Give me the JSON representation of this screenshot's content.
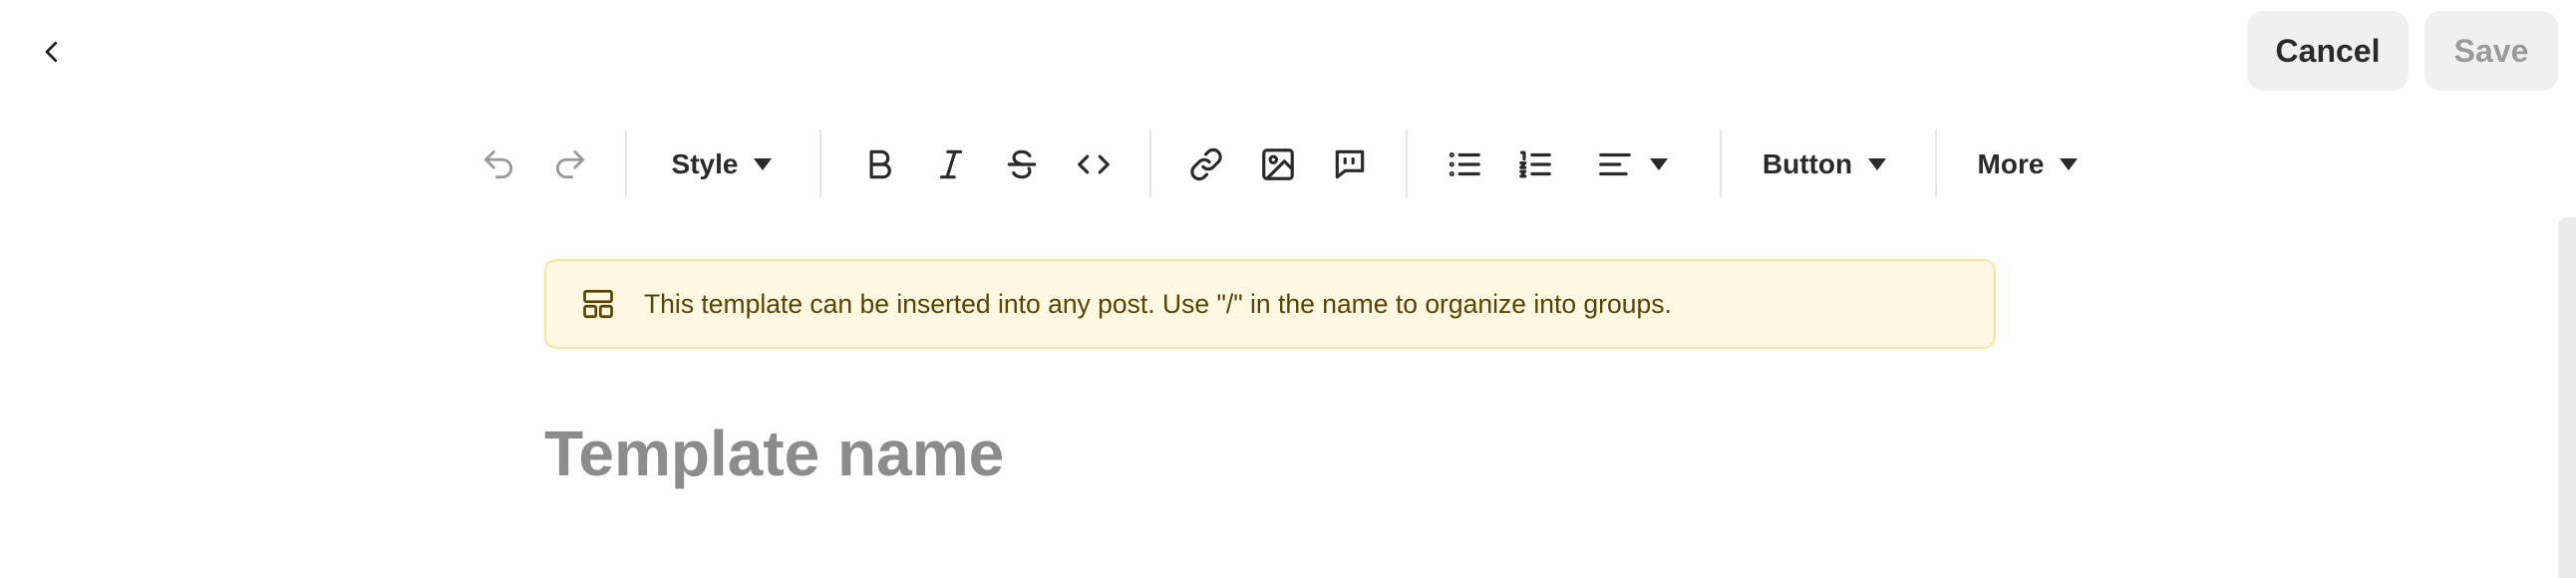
{
  "header": {
    "cancel_label": "Cancel",
    "save_label": "Save"
  },
  "toolbar": {
    "style_label": "Style",
    "button_label": "Button",
    "more_label": "More"
  },
  "banner": {
    "text": "This template can be inserted into any post. Use \"/\" in the name to organize into groups."
  },
  "editor": {
    "title_placeholder": "Template name",
    "title_value": ""
  },
  "icons": {
    "back": "chevron-left-icon",
    "undo": "undo-icon",
    "redo": "redo-icon",
    "bold": "bold-icon",
    "italic": "italic-icon",
    "strikethrough": "strikethrough-icon",
    "code": "code-icon",
    "link": "link-icon",
    "image": "image-icon",
    "quote": "quote-icon",
    "bullet_list": "bullet-list-icon",
    "numbered_list": "numbered-list-icon",
    "align": "align-left-icon",
    "template": "template-icon"
  },
  "colors": {
    "banner_bg": "#fff8e3",
    "banner_border": "#f6e4a3",
    "banner_text": "#5a4300",
    "button_bg": "#f0f0f0"
  }
}
